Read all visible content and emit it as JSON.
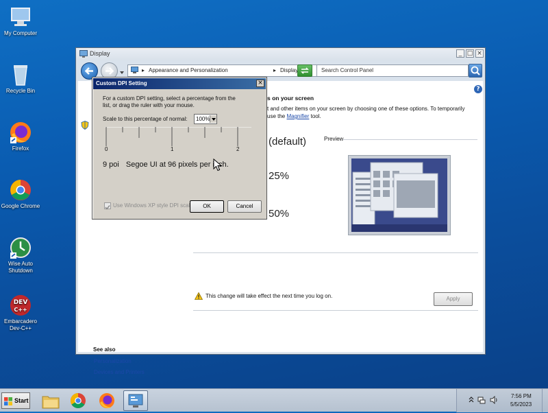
{
  "desktop": {
    "icons": [
      {
        "label": "My Computer",
        "icon": "computer-icon"
      },
      {
        "label": "Recycle Bin",
        "icon": "recycle-bin-icon"
      },
      {
        "label": "Firefox",
        "icon": "firefox-icon"
      },
      {
        "label": "Google Chrome",
        "icon": "chrome-icon"
      },
      {
        "label": "Wise Auto Shutdown",
        "icon": "wise-auto-shutdown-icon"
      },
      {
        "label": "Embarcadero Dev-C++",
        "icon": "devcpp-icon"
      }
    ]
  },
  "window": {
    "title": "Display",
    "breadcrumb": [
      "Appearance and Personalization",
      "Display"
    ],
    "search_placeholder": "Search Control Panel",
    "heading_partial": "s on your screen",
    "desc_line1": "t and other items on your screen by choosing one of these options. To temporarily",
    "desc_line2_pre": " use the ",
    "desc_link": "Magnifier",
    "desc_line2_post": " tool.",
    "option_default": "(default)",
    "option_125": "25%",
    "option_150": "50%",
    "preview_label": "Preview",
    "notice": "This change will take effect the next time you log on.",
    "apply": "Apply",
    "see_also": "See also",
    "see_also_links": [
      "Personalization",
      "Devices and Printers"
    ]
  },
  "dialog": {
    "title": "Custom DPI Setting",
    "instructions_line1": "For a custom DPI setting, select a percentage from the",
    "instructions_line2": "list, or drag the ruler with your mouse.",
    "scale_label": "Scale to this percentage of normal:",
    "scale_value": "100%",
    "ruler_labels": [
      "0",
      "1",
      "2"
    ],
    "sample_text_a": "9 poi",
    "sample_text_b": "Segoe UI at 96 pixels per inch.",
    "xp_checkbox": "Use Windows XP style DPI scal",
    "ok": "OK",
    "cancel": "Cancel"
  },
  "taskbar": {
    "start": "Start",
    "time": "7:56 PM",
    "date": "5/5/2023"
  },
  "colors": {
    "desktop_blue": "#0b5cb2",
    "dialog_title": "#0a246a",
    "link": "#1b48a8"
  }
}
